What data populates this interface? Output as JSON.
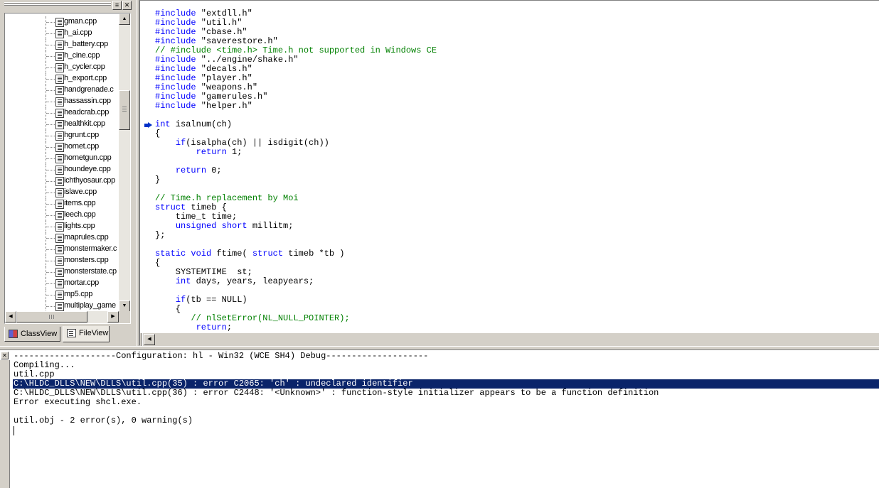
{
  "workspace": {
    "files": [
      "gman.cpp",
      "h_ai.cpp",
      "h_battery.cpp",
      "h_cine.cpp",
      "h_cycler.cpp",
      "h_export.cpp",
      "handgrenade.c",
      "hassassin.cpp",
      "headcrab.cpp",
      "healthkit.cpp",
      "hgrunt.cpp",
      "hornet.cpp",
      "hornetgun.cpp",
      "houndeye.cpp",
      "ichthyosaur.cpp",
      "islave.cpp",
      "items.cpp",
      "leech.cpp",
      "lights.cpp",
      "maprules.cpp",
      "monstermaker.c",
      "monsters.cpp",
      "monsterstate.cp",
      "mortar.cpp",
      "mp5.cpp",
      "multiplay_game"
    ],
    "tabs": {
      "classview": "ClassView",
      "fileview": "FileView"
    }
  },
  "editor": {
    "lines": [
      [
        {
          "t": "#include",
          "c": "kw"
        },
        {
          "t": " \"extdll.h\""
        }
      ],
      [
        {
          "t": "#include",
          "c": "kw"
        },
        {
          "t": " \"util.h\""
        }
      ],
      [
        {
          "t": "#include",
          "c": "kw"
        },
        {
          "t": " \"cbase.h\""
        }
      ],
      [
        {
          "t": "#include",
          "c": "kw"
        },
        {
          "t": " \"saverestore.h\""
        }
      ],
      [
        {
          "t": "// #include <time.h> Time.h not supported in Windows CE",
          "c": "cm"
        }
      ],
      [
        {
          "t": "#include",
          "c": "kw"
        },
        {
          "t": " \"../engine/shake.h\""
        }
      ],
      [
        {
          "t": "#include",
          "c": "kw"
        },
        {
          "t": " \"decals.h\""
        }
      ],
      [
        {
          "t": "#include",
          "c": "kw"
        },
        {
          "t": " \"player.h\""
        }
      ],
      [
        {
          "t": "#include",
          "c": "kw"
        },
        {
          "t": " \"weapons.h\""
        }
      ],
      [
        {
          "t": "#include",
          "c": "kw"
        },
        {
          "t": " \"gamerules.h\""
        }
      ],
      [
        {
          "t": "#include",
          "c": "kw"
        },
        {
          "t": " \"helper.h\""
        }
      ],
      [],
      [
        {
          "t": "int",
          "c": "kw"
        },
        {
          "t": " isalnum(ch)"
        }
      ],
      [
        {
          "t": "{"
        }
      ],
      [
        {
          "t": "    "
        },
        {
          "t": "if",
          "c": "kw"
        },
        {
          "t": "(isalpha(ch) || isdigit(ch))"
        }
      ],
      [
        {
          "t": "        "
        },
        {
          "t": "return",
          "c": "kw"
        },
        {
          "t": " 1;"
        }
      ],
      [],
      [
        {
          "t": "    "
        },
        {
          "t": "return",
          "c": "kw"
        },
        {
          "t": " 0;"
        }
      ],
      [
        {
          "t": "}"
        }
      ],
      [],
      [
        {
          "t": "// Time.h replacement by Moi",
          "c": "cm"
        }
      ],
      [
        {
          "t": "struct",
          "c": "kw"
        },
        {
          "t": " timeb {"
        }
      ],
      [
        {
          "t": "    time_t time;"
        }
      ],
      [
        {
          "t": "    "
        },
        {
          "t": "unsigned",
          "c": "kw"
        },
        {
          "t": " "
        },
        {
          "t": "short",
          "c": "kw"
        },
        {
          "t": " millitm;"
        }
      ],
      [
        {
          "t": "};"
        }
      ],
      [],
      [
        {
          "t": "static",
          "c": "kw"
        },
        {
          "t": " "
        },
        {
          "t": "void",
          "c": "kw"
        },
        {
          "t": " ftime( "
        },
        {
          "t": "struct",
          "c": "kw"
        },
        {
          "t": " timeb *tb )"
        }
      ],
      [
        {
          "t": "{"
        }
      ],
      [
        {
          "t": "    SYSTEMTIME  st;"
        }
      ],
      [
        {
          "t": "    "
        },
        {
          "t": "int",
          "c": "kw"
        },
        {
          "t": " days, years, leapyears;"
        }
      ],
      [],
      [
        {
          "t": "    "
        },
        {
          "t": "if",
          "c": "kw"
        },
        {
          "t": "(tb == NULL)"
        }
      ],
      [
        {
          "t": "    {"
        }
      ],
      [
        {
          "t": "       "
        },
        {
          "t": "// nlSetError(NL_NULL_POINTER);",
          "c": "cm"
        }
      ],
      [
        {
          "t": "        "
        },
        {
          "t": "return",
          "c": "kw"
        },
        {
          "t": ";"
        }
      ]
    ]
  },
  "output": {
    "lines": [
      "--------------------Configuration: hl - Win32 (WCE SH4) Debug--------------------",
      "Compiling...",
      "util.cpp",
      "C:\\HLDC_DLLS\\NEW\\DLLS\\util.cpp(35) : error C2065: 'ch' : undeclared identifier",
      "C:\\HLDC_DLLS\\NEW\\DLLS\\util.cpp(36) : error C2448: '<Unknown>' : function-style initializer appears to be a function definition",
      "Error executing shcl.exe.",
      "",
      "util.obj - 2 error(s), 0 warning(s)"
    ],
    "selected_index": 3
  },
  "icons": {
    "close": "close-icon",
    "breakpoint": "current-line-arrow-icon"
  },
  "colors": {
    "keyword": "#0000ff",
    "comment": "#008000",
    "selection": "#0a246a"
  }
}
